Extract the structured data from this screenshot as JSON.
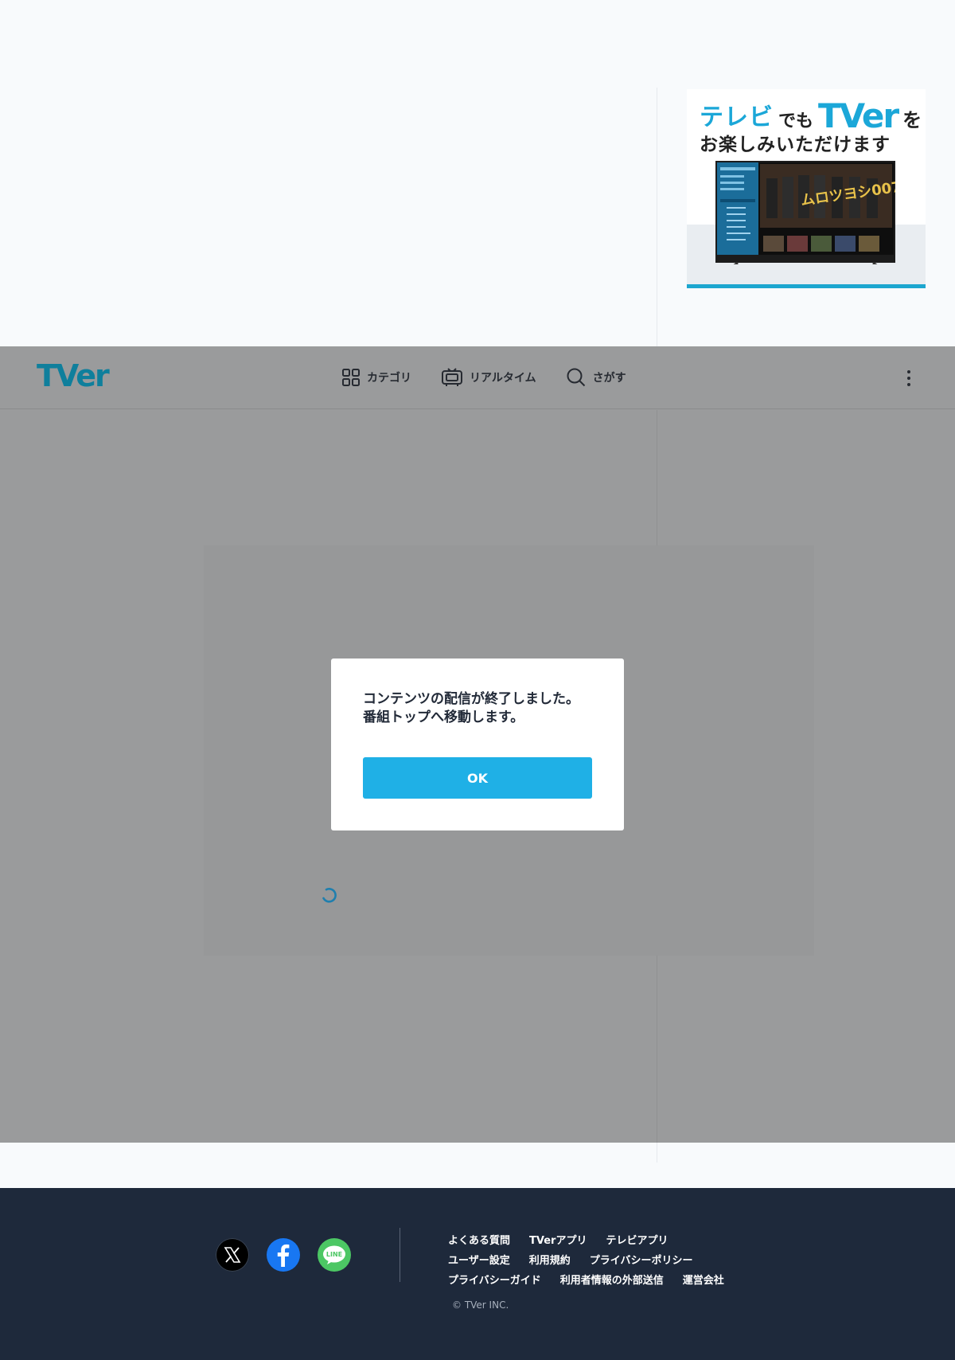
{
  "promo": {
    "line1_part1": "テレビ",
    "line1_part2": "でも",
    "line1_logo": "TVer",
    "line1_part3": "を",
    "line2": "お楽しみいただけます",
    "show_title": "ムロツヨシ007"
  },
  "header": {
    "logo": "TVer",
    "nav": [
      {
        "label": "カテゴリ",
        "icon": "grid-icon"
      },
      {
        "label": "リアルタイム",
        "icon": "tv-icon"
      },
      {
        "label": "さがす",
        "icon": "search-icon"
      }
    ],
    "menu_icon": "more-vertical-icon"
  },
  "modal": {
    "message_line1": "コンテンツの配信が終了しました。",
    "message_line2": "番組トップへ移動します。",
    "ok_label": "OK"
  },
  "footer": {
    "social": [
      {
        "name": "X",
        "icon": "x-icon"
      },
      {
        "name": "Facebook",
        "icon": "facebook-icon"
      },
      {
        "name": "LINE",
        "icon": "line-icon",
        "text": "LINE"
      }
    ],
    "links_row1": [
      "よくある質問",
      "TVerアプリ",
      "テレビアプリ"
    ],
    "links_row2": [
      "ユーザー設定",
      "利用規約",
      "プライバシーポリシー"
    ],
    "links_row3": [
      "プライバシーガイド",
      "利用者情報の外部送信",
      "運営会社"
    ],
    "copyright": "© TVer INC."
  },
  "colors": {
    "accent": "#1fb0e6",
    "brand": "#0f7f9c",
    "footer_bg": "#1e293b",
    "overlay": "#9a9b9c"
  }
}
